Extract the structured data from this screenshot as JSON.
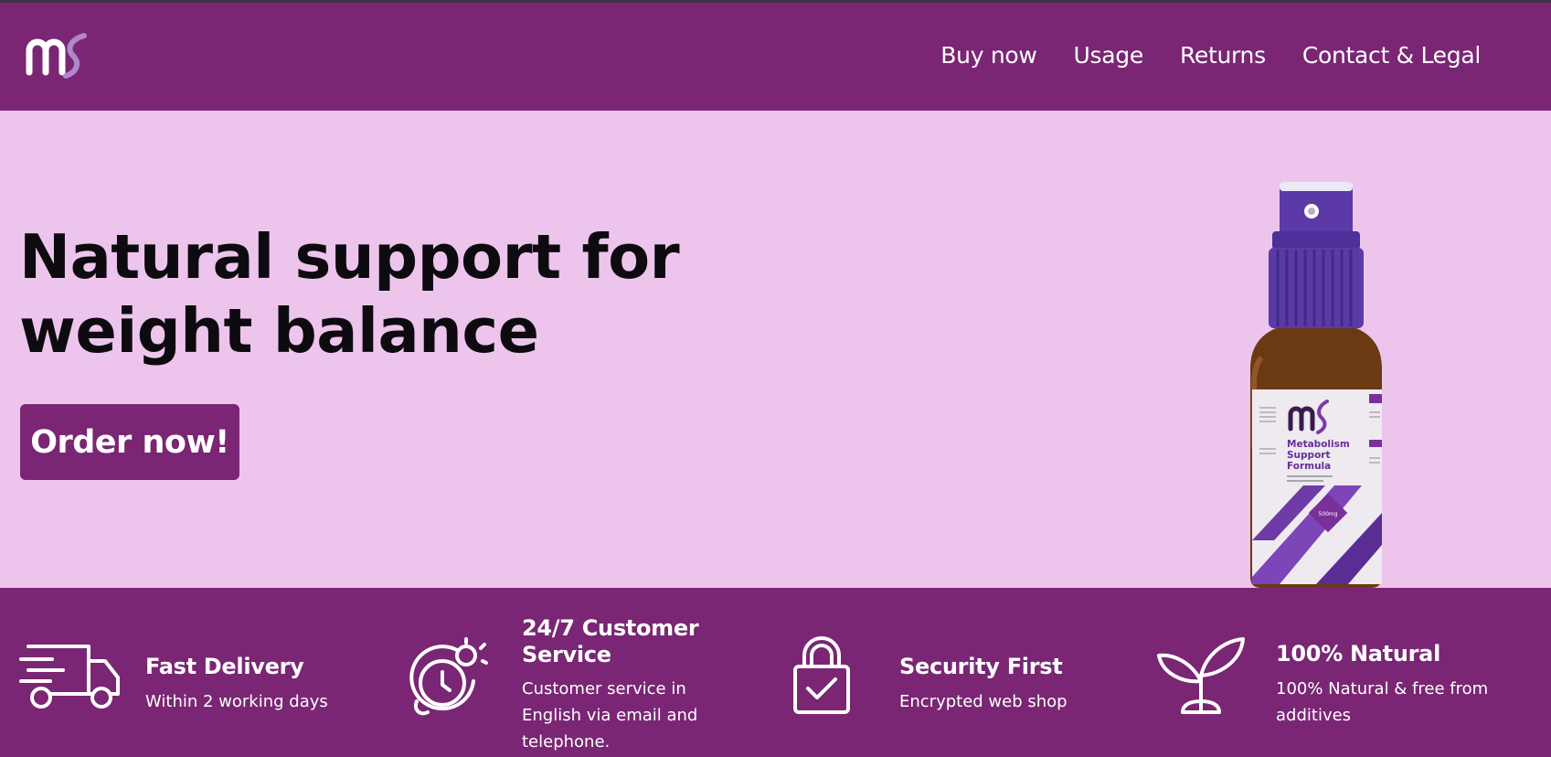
{
  "brand": {
    "logo_text": "ms",
    "accent": "#7a2674",
    "hero_bg": "#edc5ec"
  },
  "nav": [
    {
      "label": "Buy now"
    },
    {
      "label": "Usage"
    },
    {
      "label": "Returns"
    },
    {
      "label": "Contact & Legal"
    }
  ],
  "hero": {
    "headline": "Natural support for weight balance",
    "cta_label": "Order now!",
    "product_label": {
      "name_line1": "Metabolism",
      "name_line2": "Support",
      "name_line3": "Formula",
      "dose": "500mg"
    }
  },
  "features": [
    {
      "icon": "delivery-truck-icon",
      "title": "Fast Delivery",
      "text": "Within 2 working days"
    },
    {
      "icon": "clock-24-7-icon",
      "title": "24/7 Customer Service",
      "text": "Customer service in English via email and telephone."
    },
    {
      "icon": "padlock-check-icon",
      "title": "Security First",
      "text": "Encrypted web shop"
    },
    {
      "icon": "plant-sprout-icon",
      "title": "100% Natural",
      "text": "100% Natural & free from additives"
    }
  ]
}
